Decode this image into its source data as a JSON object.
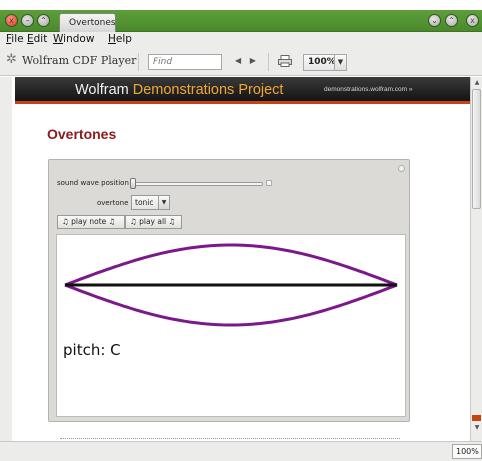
{
  "window": {
    "tab_title": "Overtones",
    "close_glyph": "x",
    "minimize_glyph": "–",
    "maximize_glyph": "⌃",
    "right_buttons": [
      "⌄",
      "⌃",
      "x"
    ]
  },
  "menu": {
    "items": [
      {
        "mnemonic": "F",
        "rest": "ile"
      },
      {
        "mnemonic": "E",
        "rest": "dit"
      },
      {
        "mnemonic": "W",
        "rest": "indow"
      },
      {
        "mnemonic": "H",
        "rest": "elp"
      }
    ]
  },
  "toolbar": {
    "player_name": "Wolfram CDF Player",
    "player_icon": "gear-icon",
    "find_placeholder": "Find",
    "nav_arrows": "◀ ▶",
    "zoom_value": "100%",
    "zoom_drop_glyph": "▼"
  },
  "banner": {
    "title_plain": "Wolfram ",
    "title_accent": "Demonstrations Project",
    "url": "demonstrations.wolfram.com »",
    "accent_color": "#f0a73a",
    "stripe_color": "#c74512"
  },
  "demo": {
    "title": "Overtones",
    "title_color": "#8b1a1a"
  },
  "controls": {
    "slider_label": "sound wave position",
    "slider_value_fraction": 0.0,
    "overtone_label": "overtone",
    "overtone_value": "tonic",
    "overtone_drop_glyph": "▼",
    "play_note_label": "♫ play note ♫",
    "play_all_label": "♫ play all ♫"
  },
  "output": {
    "pitch_text": "pitch: C",
    "wave_color": "#7a1a8a",
    "string_color": "#111111",
    "envelope_amplitude": 1.0,
    "harmonic": 1
  },
  "status": {
    "zoom": "100%"
  }
}
